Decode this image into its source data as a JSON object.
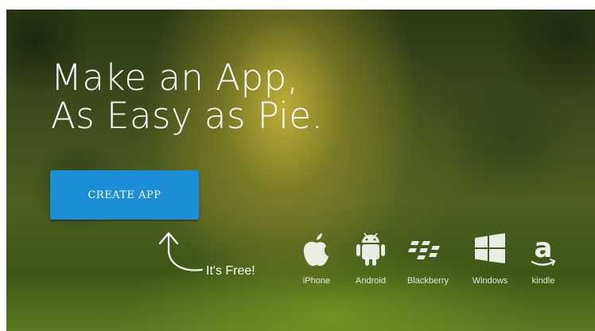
{
  "hero": {
    "headline_line1": "Make an App,",
    "headline_line2": "As Easy as Pie.",
    "cta_label": "CREATE APP",
    "free_label": "It's Free!"
  },
  "platforms": [
    {
      "label": "iPhone",
      "icon": "apple-icon"
    },
    {
      "label": "Android",
      "icon": "android-icon"
    },
    {
      "label": "Blackberry",
      "icon": "blackberry-icon"
    },
    {
      "label": "Windows",
      "icon": "windows-icon"
    },
    {
      "label": "kindle",
      "icon": "amazon-icon"
    }
  ],
  "colors": {
    "cta_background": "#1c8ed8",
    "text": "#ffffff"
  }
}
